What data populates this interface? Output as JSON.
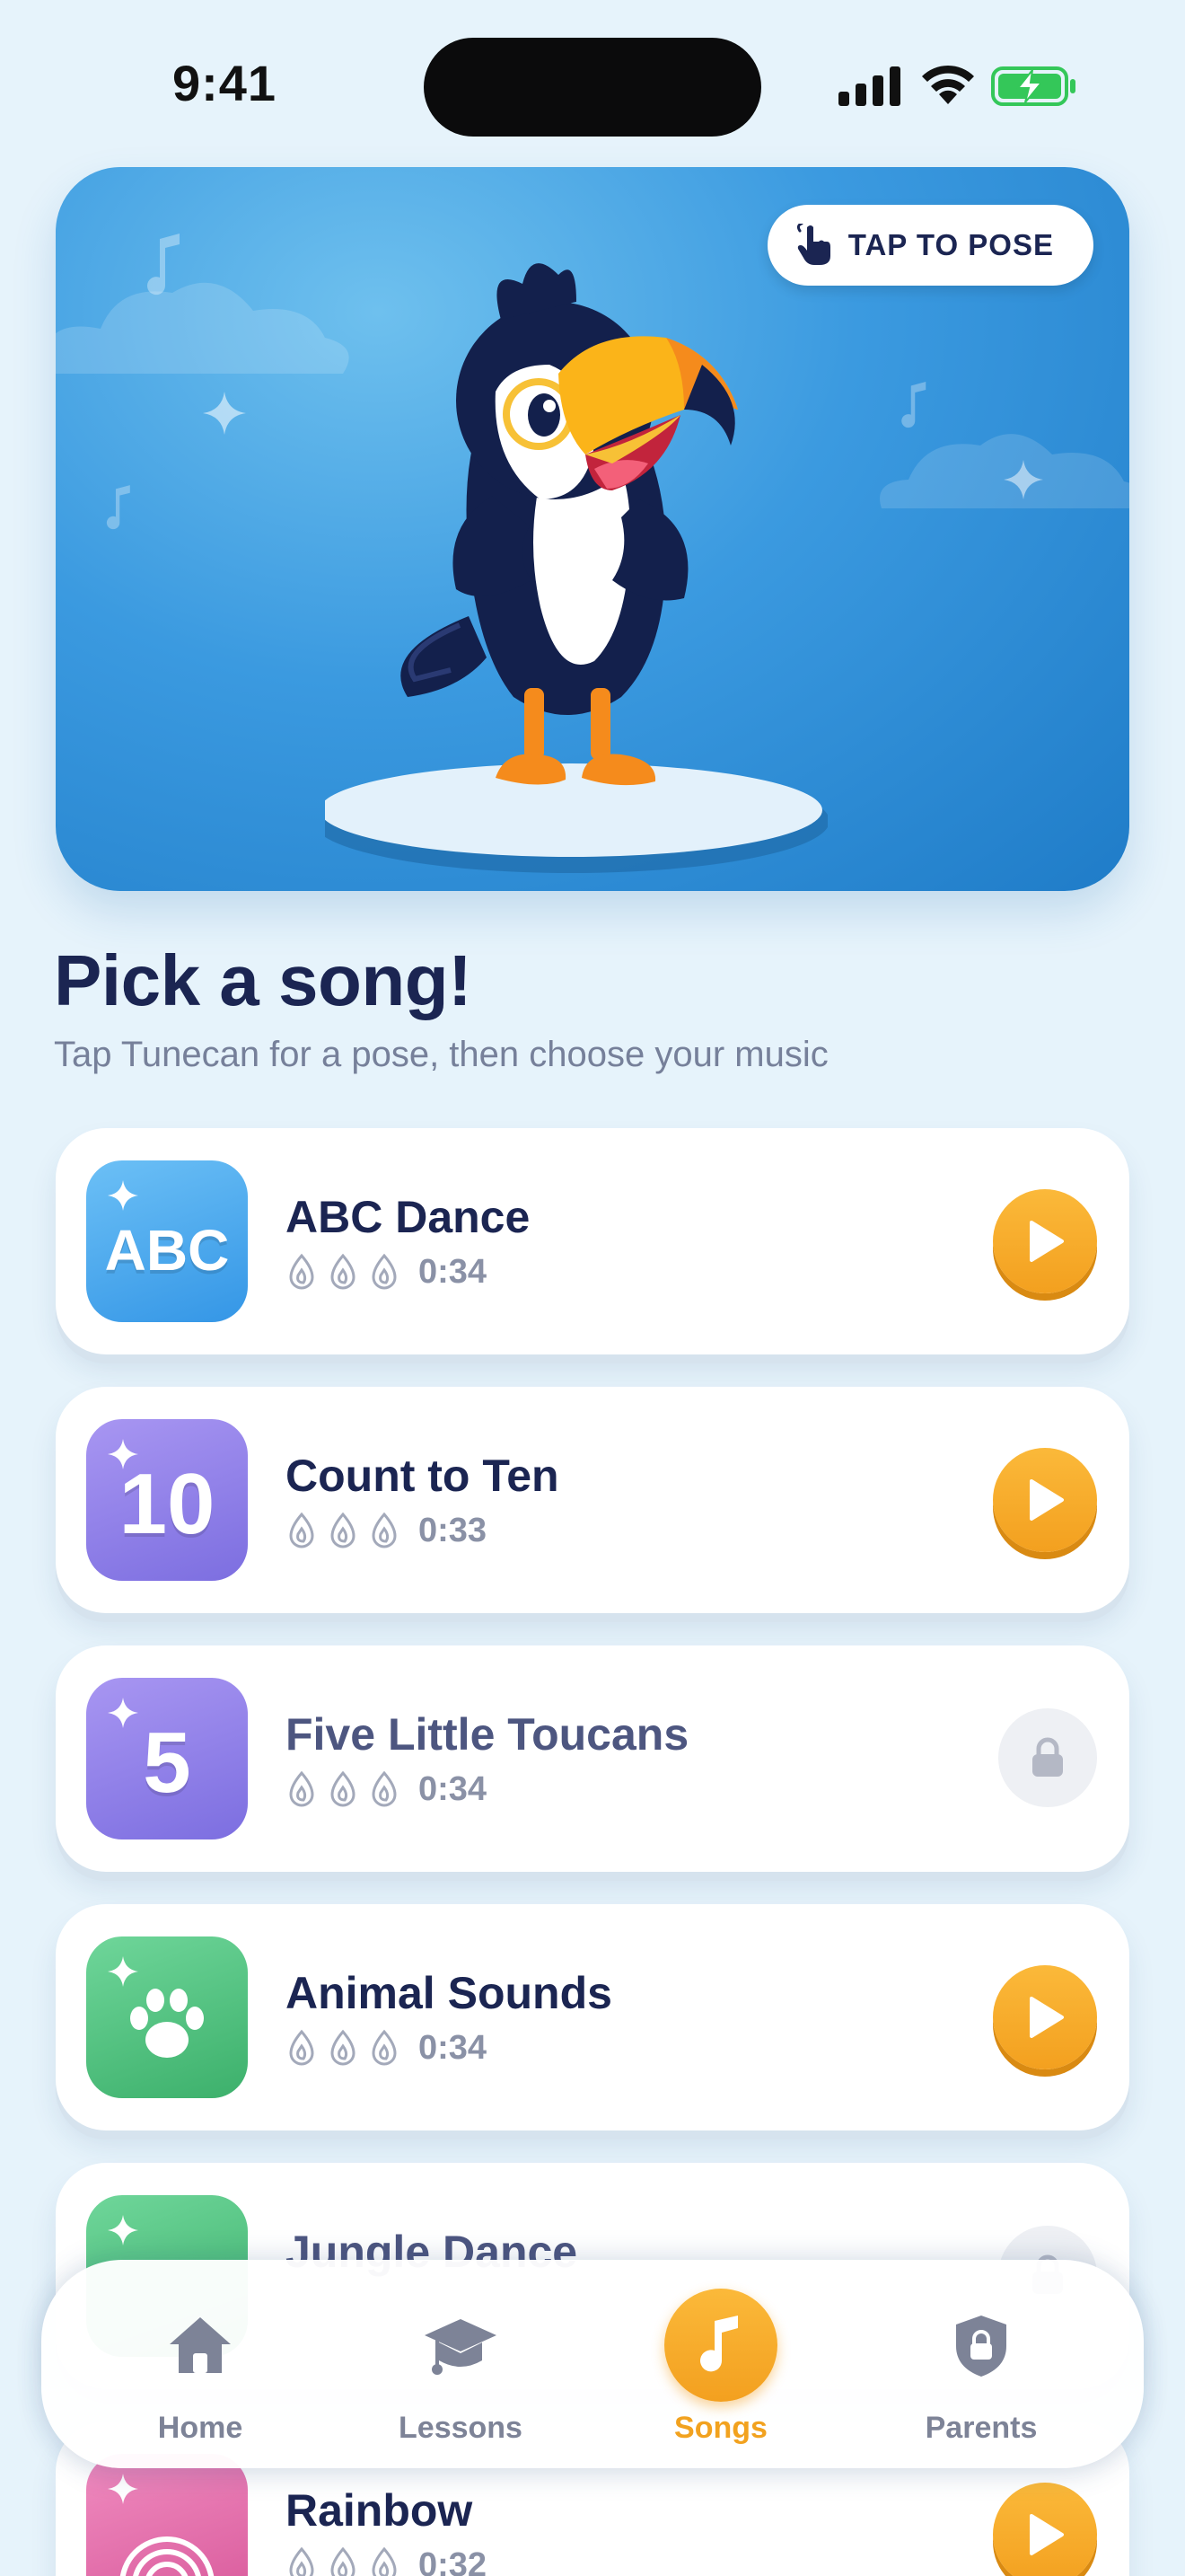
{
  "status_bar": {
    "time": "9:41"
  },
  "hero": {
    "tap_button_label": "TAP TO POSE",
    "colors": {
      "sky_top": "#6ec0ee",
      "sky_bottom": "#1f7cc8"
    }
  },
  "header": {
    "title": "Pick a song!",
    "subtitle": "Tap Tunecan for a pose, then choose your music"
  },
  "songs": [
    {
      "title": "ABC Dance",
      "duration": "0:34",
      "thumb_text": "ABC",
      "locked": false,
      "thumb_color": "#4aa6ee"
    },
    {
      "title": "Count to Ten",
      "duration": "0:33",
      "thumb_text": "10",
      "locked": false,
      "thumb_color": "#8a7ee6"
    },
    {
      "title": "Five Little Toucans",
      "duration": "0:34",
      "thumb_text": "5",
      "locked": true,
      "thumb_color": "#8a7ee6"
    },
    {
      "title": "Animal Sounds",
      "duration": "0:34",
      "thumb_text": "",
      "thumb_icon": "paw-icon",
      "locked": false,
      "thumb_color": "#4cc07a"
    },
    {
      "title": "Jungle Dance",
      "duration": "",
      "thumb_text": "",
      "locked": true,
      "thumb_color": "#4cc07a"
    },
    {
      "title": "Rainbow",
      "duration": "0:32",
      "thumb_text": "",
      "thumb_icon": "rainbow-icon",
      "locked": false,
      "thumb_color": "#e46aa8"
    }
  ],
  "nav": {
    "items": [
      {
        "label": "Home",
        "icon": "home-icon",
        "active": false
      },
      {
        "label": "Lessons",
        "icon": "graduation-cap-icon",
        "active": false
      },
      {
        "label": "Songs",
        "icon": "music-note-icon",
        "active": true
      },
      {
        "label": "Parents",
        "icon": "shield-lock-icon",
        "active": false
      }
    ],
    "accent_color": "#f2a21f"
  }
}
